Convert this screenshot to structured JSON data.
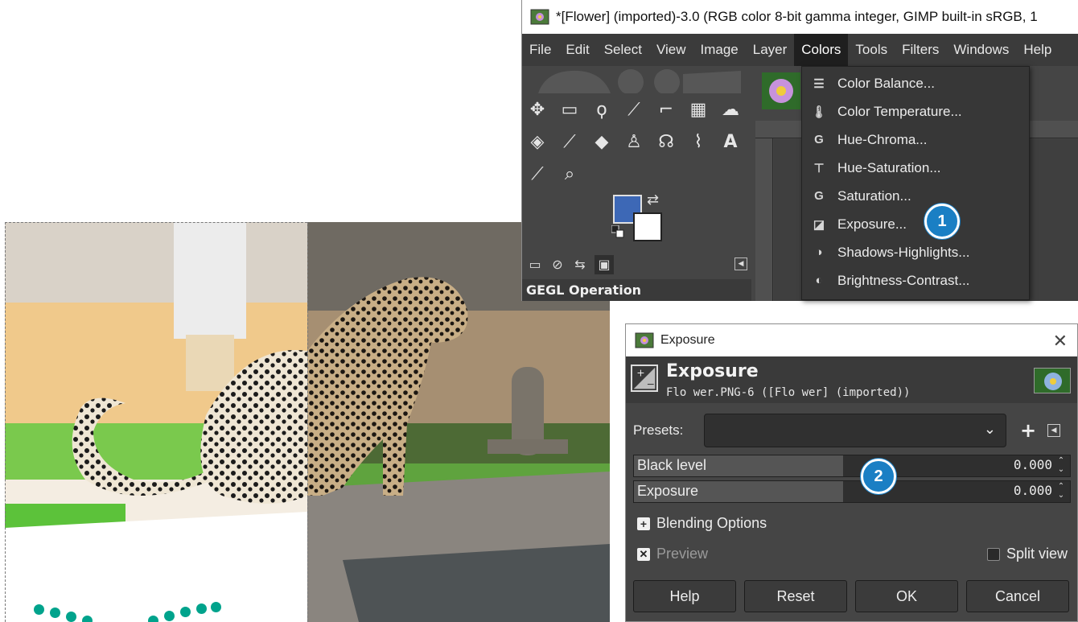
{
  "gimp": {
    "title": "*[Flower] (imported)-3.0 (RGB color 8-bit gamma integer, GIMP built-in sRGB, 1",
    "menu": [
      "File",
      "Edit",
      "Select",
      "View",
      "Image",
      "Layer",
      "Colors",
      "Tools",
      "Filters",
      "Windows",
      "Help"
    ],
    "active_menu": "Colors",
    "gegl_label": "GEGL Operation",
    "fg_color": "#3d68b6",
    "bg_color": "#ffffff"
  },
  "colors_menu": {
    "items": [
      {
        "label": "Color Balance...",
        "icon": "color-balance-icon"
      },
      {
        "label": "Color Temperature...",
        "icon": "thermometer-icon"
      },
      {
        "label": "Hue-Chroma...",
        "icon": "gegl-icon"
      },
      {
        "label": "Hue-Saturation...",
        "icon": "hue-saturation-icon"
      },
      {
        "label": "Saturation...",
        "icon": "gegl-icon"
      },
      {
        "label": "Exposure...",
        "icon": "exposure-icon"
      },
      {
        "label": "Shadows-Highlights...",
        "icon": "shadows-highlights-icon"
      },
      {
        "label": "Brightness-Contrast...",
        "icon": "brightness-contrast-icon"
      }
    ]
  },
  "badges": {
    "one": "1",
    "two": "2",
    "color": "#1a7fc4"
  },
  "exposure_dialog": {
    "window_title": "Exposure",
    "title": "Exposure",
    "subtitle": "Flo wer.PNG-6 ([Flo wer] (imported))",
    "presets_label": "Presets:",
    "presets_value": "",
    "sliders": [
      {
        "label": "Black level",
        "value": "0.000"
      },
      {
        "label": "Exposure",
        "value": "0.000"
      }
    ],
    "blending_options": "Blending Options",
    "preview": {
      "label": "Preview",
      "checked": true
    },
    "split_view": {
      "label": "Split view",
      "checked": false
    },
    "buttons": {
      "help": "Help",
      "reset": "Reset",
      "ok": "OK",
      "cancel": "Cancel"
    }
  },
  "decor": {
    "dot_color": "#00a38c"
  }
}
